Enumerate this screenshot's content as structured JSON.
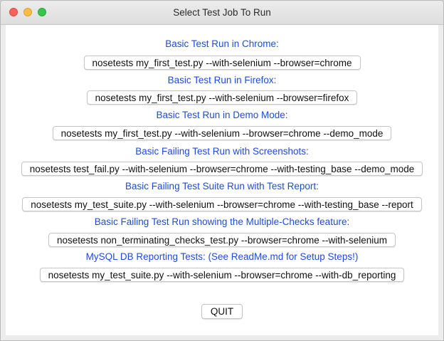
{
  "window": {
    "title": "Select Test Job To Run"
  },
  "jobs": [
    {
      "label": "Basic Test Run in Chrome:",
      "command": "nosetests my_first_test.py --with-selenium --browser=chrome"
    },
    {
      "label": "Basic Test Run in Firefox:",
      "command": "nosetests my_first_test.py --with-selenium --browser=firefox"
    },
    {
      "label": "Basic Test Run in Demo Mode:",
      "command": "nosetests my_first_test.py --with-selenium --browser=chrome --demo_mode"
    },
    {
      "label": "Basic Failing Test Run with Screenshots:",
      "command": "nosetests test_fail.py --with-selenium --browser=chrome --with-testing_base --demo_mode"
    },
    {
      "label": "Basic Failing Test Suite Run with Test Report:",
      "command": "nosetests my_test_suite.py --with-selenium --browser=chrome --with-testing_base --report"
    },
    {
      "label": "Basic Failing Test Run showing the Multiple-Checks feature:",
      "command": "nosetests non_terminating_checks_test.py --browser=chrome --with-selenium"
    },
    {
      "label": "MySQL DB Reporting Tests: (See ReadMe.md for Setup Steps!)",
      "command": "nosetests my_test_suite.py --with-selenium --browser=chrome --with-db_reporting"
    }
  ],
  "footer": {
    "quit_label": "QUIT"
  },
  "colors": {
    "label_blue": "#1f4bdb",
    "close": "#fc605b",
    "minimize": "#fdbc40",
    "maximize": "#34c84a"
  }
}
